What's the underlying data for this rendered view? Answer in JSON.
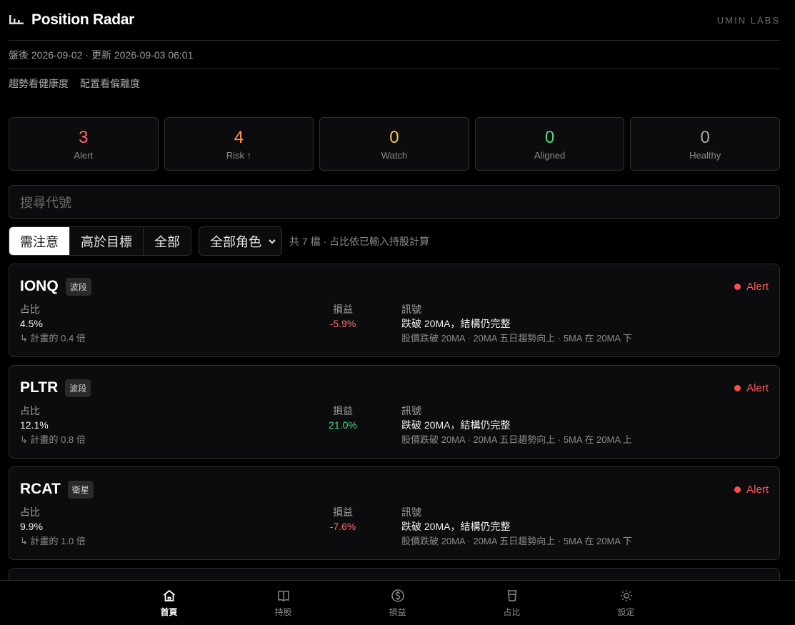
{
  "header": {
    "title": "Position Radar",
    "labs": "UMIN LABS"
  },
  "status_line": "盤後 2026-09-02 · 更新 2026-09-03 06:01",
  "links": [
    "趨勢看健康度",
    "配置看偏離度"
  ],
  "stats": [
    {
      "num": "3",
      "label": "Alert",
      "color": "#ff6b6b"
    },
    {
      "num": "4",
      "label": "Risk ↑",
      "color": "#ff9a5a"
    },
    {
      "num": "0",
      "label": "Watch",
      "color": "#f4c542"
    },
    {
      "num": "0",
      "label": "Aligned",
      "color": "#4ade80"
    },
    {
      "num": "0",
      "label": "Healthy",
      "color": "#a8a8a8"
    }
  ],
  "search": {
    "placeholder": "搜尋代號"
  },
  "filters": {
    "segments": [
      "需注意",
      "高於目標",
      "全部"
    ],
    "active_segment": "需注意",
    "role_select": "全部角色",
    "count_note": "共 7 檔 · 占比依已輸入持股計算"
  },
  "positions": [
    {
      "ticker": "IONQ",
      "role": "波段",
      "status": "Alert",
      "share_label": "占比",
      "share": "4.5%",
      "plan_ratio": "↳ 計畫的 0.4 倍",
      "pnl_label": "損益",
      "pnl": "-5.9%",
      "pnl_sign": "neg",
      "signal_label": "訊號",
      "signal": "跌破 20MA，結構仍完整",
      "signal_detail": "股價跌破 20MA · 20MA 五日趨勢向上 · 5MA 在 20MA 下"
    },
    {
      "ticker": "PLTR",
      "role": "波段",
      "status": "Alert",
      "share_label": "占比",
      "share": "12.1%",
      "plan_ratio": "↳ 計畫的 0.8 倍",
      "pnl_label": "損益",
      "pnl": "21.0%",
      "pnl_sign": "pos",
      "signal_label": "訊號",
      "signal": "跌破 20MA，結構仍完整",
      "signal_detail": "股價跌破 20MA · 20MA 五日趨勢向上 · 5MA 在 20MA 上"
    },
    {
      "ticker": "RCAT",
      "role": "衛星",
      "status": "Alert",
      "share_label": "占比",
      "share": "9.9%",
      "plan_ratio": "↳ 計畫的 1.0 倍",
      "pnl_label": "損益",
      "pnl": "-7.6%",
      "pnl_sign": "neg",
      "signal_label": "訊號",
      "signal": "跌破 20MA，結構仍完整",
      "signal_detail": "股價跌破 20MA · 20MA 五日趨勢向上 · 5MA 在 20MA 下"
    }
  ],
  "nav": [
    {
      "label": "首頁",
      "icon": "home-icon",
      "active": true
    },
    {
      "label": "持股",
      "icon": "book-icon",
      "active": false
    },
    {
      "label": "損益",
      "icon": "dollar-icon",
      "active": false
    },
    {
      "label": "占比",
      "icon": "cup-icon",
      "active": false
    },
    {
      "label": "設定",
      "icon": "sun-icon",
      "active": false
    }
  ]
}
